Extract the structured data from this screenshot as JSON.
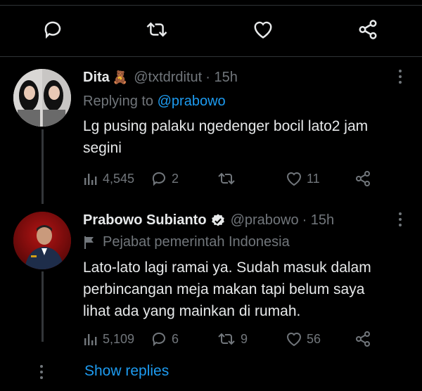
{
  "top_actions": [
    "reply-icon",
    "retweet-icon",
    "like-icon",
    "share-icon"
  ],
  "tweets": [
    {
      "name": "Dita",
      "emoji": "🧸",
      "handle": "@txtdrditut",
      "time": "· 15h",
      "replying_prefix": "Replying to",
      "replying_to": "@prabowo",
      "text": "Lg pusing palaku ngedenger bocil lato2 jam segini",
      "views": "4,545",
      "replies": "2",
      "retweets": "",
      "likes": "11"
    },
    {
      "name": "Prabowo Subianto",
      "verified": true,
      "handle": "@prabowo",
      "time": "· 15h",
      "label": "Pejabat pemerintah Indonesia",
      "text": "Lato-lato lagi ramai ya. Sudah masuk dalam perbincangan meja makan tapi belum saya lihat ada yang mainkan di rumah.",
      "views": "5,109",
      "replies": "6",
      "retweets": "9",
      "likes": "56"
    }
  ],
  "show_replies": "Show replies",
  "colors": {
    "background": "#000000",
    "text": "#e7e9ea",
    "muted": "#71767b",
    "accent": "#1d9bf0",
    "verified_badge": "#ffffff"
  }
}
